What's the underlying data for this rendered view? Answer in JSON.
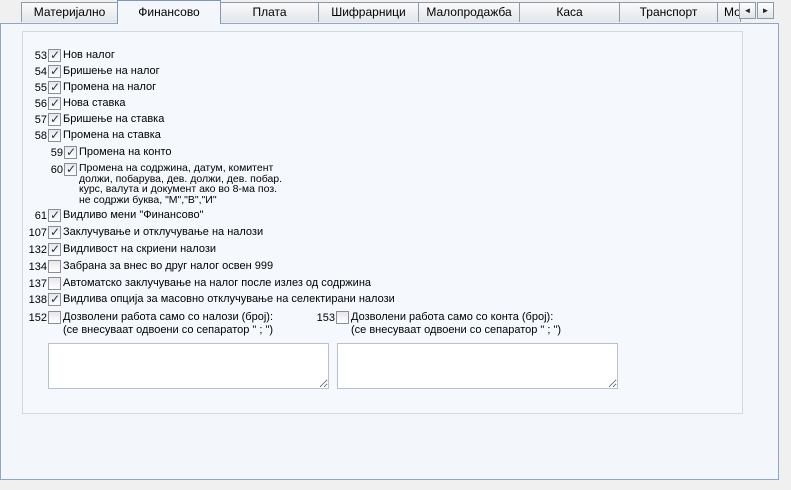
{
  "tabs": [
    {
      "label": "Материјално"
    },
    {
      "label": "Финансово"
    },
    {
      "label": "Плата"
    },
    {
      "label": "Шифрарници"
    },
    {
      "label": "Малопродажба"
    },
    {
      "label": "Каса"
    },
    {
      "label": "Транспорт"
    },
    {
      "label": "Мо"
    }
  ],
  "active_tab": "Финансово",
  "scroll": {
    "left_icon": "arrow-left-icon",
    "right_icon": "arrow-right-icon",
    "left_glyph": "◄",
    "right_glyph": "►"
  },
  "permissions": [
    {
      "num": "53",
      "label": "Нов налог",
      "checked": true
    },
    {
      "num": "54",
      "label": "Бришење на налог",
      "checked": true
    },
    {
      "num": "55",
      "label": "Промена на налог",
      "checked": true
    },
    {
      "num": "56",
      "label": "Нова ставка",
      "checked": true
    },
    {
      "num": "57",
      "label": "Бришење на ставка",
      "checked": true
    },
    {
      "num": "58",
      "label": "Промена на ставка",
      "checked": true
    },
    {
      "num": "59",
      "label": "Промена на конто",
      "checked": true
    },
    {
      "num": "60",
      "label": "Промена на содржина, датум, комитент\nдолжи, побарува, дев. должи, дев. побар.\nкурс, валута и документ ако во 8-ма поз.\nне содржи буква, \"М\",\"В\",\"И\"",
      "checked": true
    },
    {
      "num": "61",
      "label": "Видливо мени \"Финансово\"",
      "checked": true
    },
    {
      "num": "107",
      "label": "Заклучување и отклучување на налози",
      "checked": true
    },
    {
      "num": "132",
      "label": "Видливост на скриени налози",
      "checked": true
    },
    {
      "num": "134",
      "label": "Забрана за внес во друг налог освен 999",
      "checked": false
    },
    {
      "num": "137",
      "label": "Автоматско заклучување на налог после излез од содржина",
      "checked": false
    },
    {
      "num": "138",
      "label": "Видлива опција за масовно отклучување на селектирани налози",
      "checked": true
    },
    {
      "num": "152",
      "label": "Дозволени работа само со налози (број):\n(се внесуваат одвоени со сепаратор \" ; \")",
      "checked": false
    },
    {
      "num": "153",
      "label": "Дозволени работа само со конта (број):\n(се внесуваат одвоени со сепаратор \" ; \")",
      "checked": false
    }
  ],
  "inputs": {
    "nalozi_value": "",
    "konta_value": ""
  },
  "colors": {
    "check": "#1e2f5a",
    "page_bg": "#f3f6fb",
    "border": "#8fa6c4"
  }
}
